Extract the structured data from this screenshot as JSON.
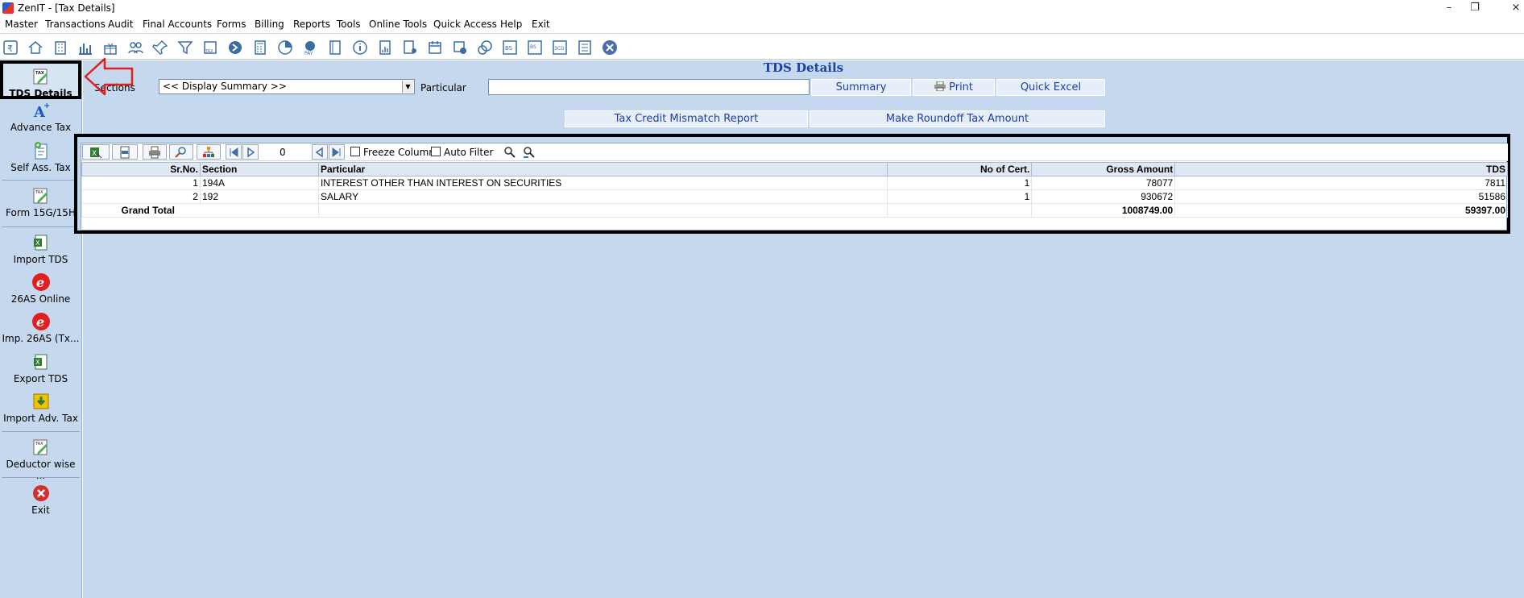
{
  "window": {
    "title": "ZenIT - [Tax Details]",
    "minimize": "–",
    "restore": "❐",
    "close": "×"
  },
  "menu": [
    "Master",
    "Transactions",
    "Audit",
    "Final Accounts",
    "Forms",
    "Billing",
    "Reports",
    "Tools",
    "Online Tools",
    "Quick Access",
    "Help",
    "Exit"
  ],
  "toolbar_icons": [
    "rupee-icon",
    "home-icon",
    "building-icon",
    "bar-chart-icon",
    "gift-icon",
    "users-icon",
    "pin-icon",
    "filter-icon",
    "tax-icon",
    "arrow-circle-icon",
    "calculator-icon",
    "pie-chart-icon",
    "pay-icon",
    "book-icon",
    "info-icon",
    "report-icon",
    "user-report-icon",
    "calendar-icon",
    "transfer-icon",
    "bs-icon",
    "bs2-icon",
    "3cd-icon",
    "grid-report-icon",
    "close-circle-icon"
  ],
  "sidebar": {
    "items": [
      {
        "label": "TDS Details",
        "icon": "tax-pencil-icon"
      },
      {
        "label": "Advance Tax",
        "icon": "advance-tax-icon"
      },
      {
        "label": "Self Ass. Tax",
        "icon": "self-assessment-icon"
      },
      {
        "label": "Form 15G/15H",
        "icon": "tax-pencil-icon"
      },
      {
        "label": "Import TDS",
        "icon": "excel-icon"
      },
      {
        "label": "26AS Online",
        "icon": "e-icon"
      },
      {
        "label": "Imp. 26AS (Tx...",
        "icon": "e-icon"
      },
      {
        "label": "Export TDS",
        "icon": "excel-icon"
      },
      {
        "label": "Import Adv. Tax",
        "icon": "import-icon"
      },
      {
        "label": "Deductor wise ...",
        "icon": "tax-pencil-icon"
      },
      {
        "label": "Exit",
        "icon": "exit-icon"
      }
    ]
  },
  "main": {
    "title": "TDS Details",
    "sections_label": "Sections",
    "sections_value": "<< Display Summary >>",
    "particular_label": "Particular",
    "particular_value": "",
    "buttons": {
      "summary": "Summary",
      "print": "Print",
      "quick_excel": "Quick Excel",
      "tax_credit": "Tax Credit Mismatch Report",
      "roundoff": "Make Roundoff Tax Amount"
    }
  },
  "grid": {
    "page_number": "0",
    "freeze_column": "Freeze Column",
    "auto_filter": "Auto Filter",
    "columns": [
      "Sr.No.",
      "Section",
      "Particular",
      "No of Cert.",
      "Gross Amount",
      "TDS"
    ],
    "rows": [
      {
        "srno": "1",
        "section": "194A",
        "particular": "INTEREST OTHER THAN INTEREST ON SECURITIES",
        "certs": "1",
        "gross": "78077",
        "tds": "7811"
      },
      {
        "srno": "2",
        "section": "192",
        "particular": "SALARY",
        "certs": "1",
        "gross": "930672",
        "tds": "51586"
      }
    ],
    "total": {
      "label": "Grand Total",
      "gross": "1008749.00",
      "tds": "59397.00"
    }
  },
  "colors": {
    "accent": "#1c3fa8",
    "panel": "#c5d8ee",
    "highlight_border": "#000000",
    "annotation": "#e02020"
  }
}
